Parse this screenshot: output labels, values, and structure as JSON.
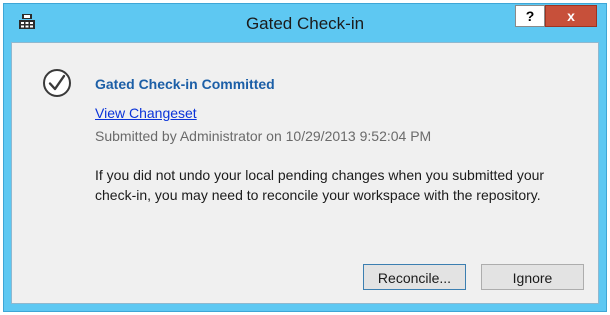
{
  "window": {
    "title": "Gated Check-in",
    "help_label": "?",
    "close_label": "x",
    "icon": "app-icon"
  },
  "content": {
    "status_icon": "check-circle-icon",
    "heading": "Gated Check-in Committed",
    "link_text": "View Changeset",
    "submitted_text": "Submitted by Administrator on 10/29/2013 9:52:04 PM",
    "message": "If you did not undo your local pending changes when you submitted your check-in, you may need to reconcile your workspace with the repository."
  },
  "buttons": {
    "reconcile_label": "Reconcile...",
    "ignore_label": "Ignore"
  },
  "colors": {
    "title_bar": "#5ec8f2",
    "close_button": "#c7503a",
    "heading": "#1c5fa7",
    "link": "#0a33d9"
  }
}
